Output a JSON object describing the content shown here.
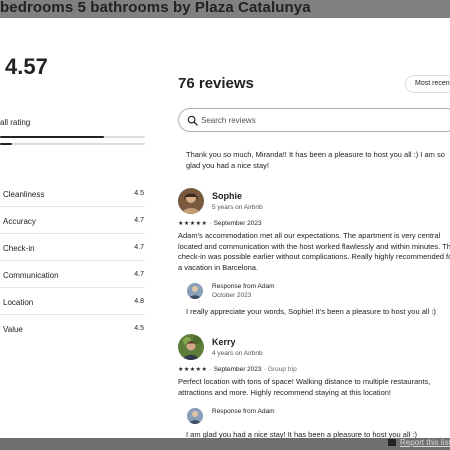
{
  "title": "bedrooms 5 bathrooms by Plaza Catalunya",
  "rating": {
    "score": "4.57",
    "overall_label": "all rating",
    "distribution": [
      0.72,
      0.08,
      0,
      0,
      0
    ],
    "categories": [
      {
        "label": "Cleanliness",
        "value": "4.5"
      },
      {
        "label": "Accuracy",
        "value": "4.7"
      },
      {
        "label": "Check-in",
        "value": "4.7"
      },
      {
        "label": "Communication",
        "value": "4.7"
      },
      {
        "label": "Location",
        "value": "4.8"
      },
      {
        "label": "Value",
        "value": "4.5"
      }
    ]
  },
  "reviews_header": {
    "count": "76 reviews",
    "sort_label": "Most recent"
  },
  "search": {
    "placeholder": "Search reviews"
  },
  "prev_reply": "Thank you so much, Miranda!! It has been a pleasure to host you all :) I am so glad you had a nice stay!",
  "reviews": [
    {
      "name": "Sophie",
      "subtitle": "5 years on Airbnb",
      "stars": "★★★★★",
      "date": "September 2023",
      "trip": "",
      "body": "Adam's accommodation met all our expectations. The apartment is very central located and communication with the host worked flawlessly and within minutes. The check-in was possible earlier without complications. Really highly recommended for a vacation in Barcelona.",
      "response_label": "Response from Adam",
      "response_date": "October 2023",
      "response_text": "I really appreciate your words, Sophie! It's been a pleasure to host you all :)"
    },
    {
      "name": "Kerry",
      "subtitle": "4 years on Airbnb",
      "stars": "★★★★★",
      "date": "September 2023",
      "trip": "Group trip",
      "body": "Perfect location with tons of space! Walking distance to multiple restaurants, attractions and more. Highly recommend staying at this location!",
      "response_label": "Response from Adam",
      "response_date": "",
      "response_text": "I am glad you had a nice stay! It has been a pleasure to host you all :)"
    }
  ],
  "footer": {
    "report_label": "Report this listing"
  },
  "colors": {
    "text": "#222222",
    "divider": "#e6e6e6",
    "bar_track": "#dddddd"
  }
}
